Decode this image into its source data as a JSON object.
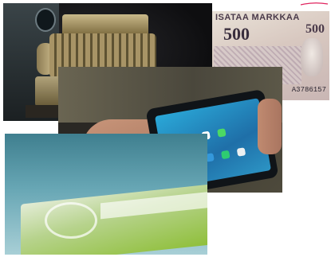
{
  "collage": {
    "photos": [
      {
        "subject": "antique cash register"
      },
      {
        "subject": "finnish 500 markka banknote",
        "title_text": "ISATAA MARKKAA",
        "value_text": "500",
        "corner_value_text": "500",
        "serial_text": "A3786157"
      },
      {
        "subject": "smartphone held in hand with smartwatch on wrist"
      },
      {
        "subject": "contactless credit card"
      }
    ]
  },
  "colors": {
    "pen_stroke": "#e0245e",
    "background": "#ffffff"
  }
}
